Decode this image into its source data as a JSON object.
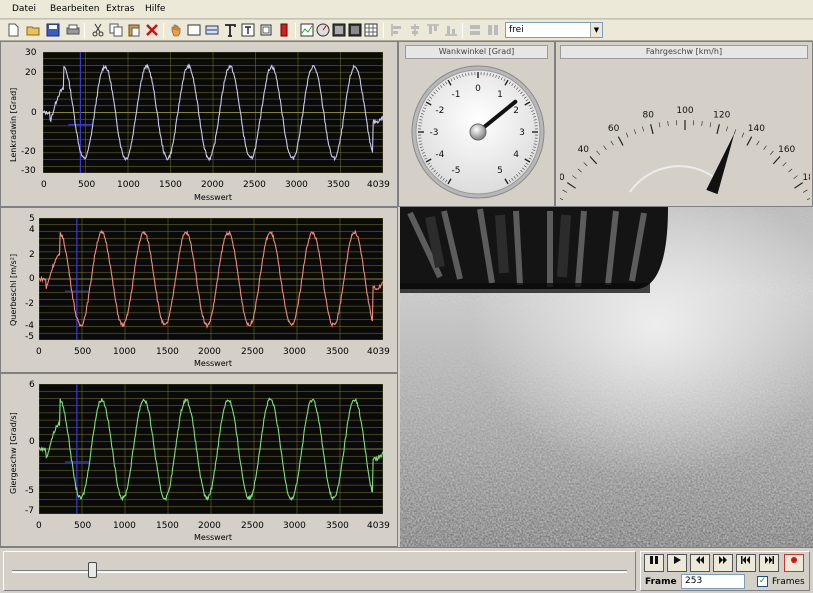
{
  "menu": {
    "items": [
      "Datei",
      "Bearbeiten",
      "Extras",
      "Hilfe"
    ]
  },
  "toolbar": {
    "mode_value": "frei"
  },
  "plots": [
    {
      "ylabel": "Lenkradwin [Grad]",
      "xlabel": "Messwert",
      "yticks": [
        "30",
        "20",
        "0",
        "-20",
        "-30"
      ],
      "xticks": [
        "0",
        "500",
        "1000",
        "1500",
        "2000",
        "2500",
        "3000",
        "3500",
        "4039"
      ],
      "color": "#c8c8f0",
      "amplitude": 20
    },
    {
      "ylabel": "Querbeschl [m/s²]",
      "xlabel": "Messwert",
      "yticks": [
        "5",
        "4",
        "2",
        "0",
        "-2",
        "-4",
        "-5"
      ],
      "xticks": [
        "0",
        "500",
        "1000",
        "1500",
        "2000",
        "2500",
        "3000",
        "3500",
        "4039"
      ],
      "color": "#f08a7a",
      "amplitude": 4
    },
    {
      "ylabel": "Giergeschw [Grad/s]",
      "xlabel": "Messwert",
      "yticks": [
        "6",
        "0",
        "-5",
        "-7"
      ],
      "xticks": [
        "0",
        "500",
        "1000",
        "1500",
        "2000",
        "2500",
        "3000",
        "3500",
        "4039"
      ],
      "color": "#7ee07a",
      "amplitude": 6
    }
  ],
  "gauges": {
    "wank": {
      "title": "Wankwinkel [Grad]",
      "labels": [
        "0",
        "1",
        "2",
        "3",
        "4",
        "5",
        "-5",
        "-4",
        "-3",
        "-2",
        "-1"
      ],
      "value": 1.7
    },
    "speed": {
      "title": "Fahrgeschw [km/h]",
      "labels": [
        "0",
        "20",
        "40",
        "60",
        "80",
        "100",
        "120",
        "140",
        "160",
        "180",
        "200"
      ],
      "value": 130
    }
  },
  "playback": {
    "slider_fraction": 0.13,
    "frame_label": "Frame",
    "frame_value": "253",
    "frames_checkbox_label": "Frames",
    "frames_checked": true,
    "buttons": [
      "pause-icon",
      "play-icon",
      "rewind-icon",
      "fast-forward-icon",
      "skip-back-icon",
      "skip-forward-icon",
      "record-icon"
    ]
  }
}
